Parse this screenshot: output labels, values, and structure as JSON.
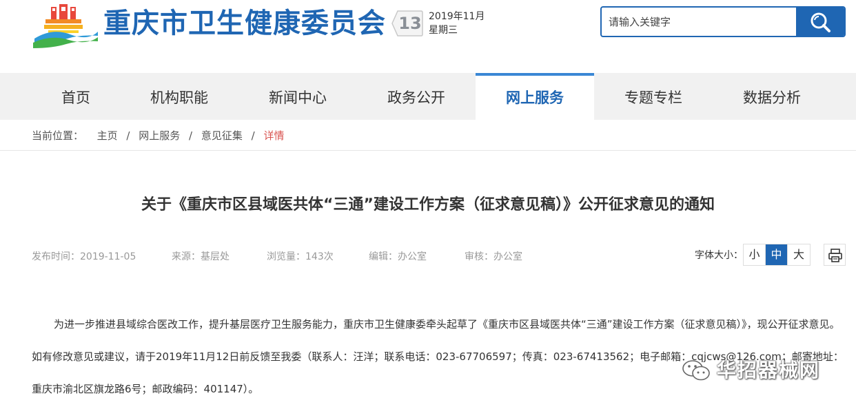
{
  "header": {
    "site_title": "重庆市卫生健康委员会",
    "date_day": "13",
    "date_month": "2019年11月",
    "date_weekday": "星期三"
  },
  "search": {
    "placeholder": "请输入关键字",
    "button_icon": "search-icon"
  },
  "nav": {
    "items": [
      {
        "label": "首页"
      },
      {
        "label": "机构职能"
      },
      {
        "label": "新闻中心"
      },
      {
        "label": "政务公开"
      },
      {
        "label": "网上服务"
      },
      {
        "label": "专题专栏"
      },
      {
        "label": "数据分析"
      }
    ],
    "active_index": 4
  },
  "breadcrumb": {
    "label": "当前位置：",
    "items": [
      "主页",
      "网上服务",
      "意见征集"
    ],
    "current": "详情",
    "separator": "/"
  },
  "article": {
    "title": "关于《重庆市区县域医共体“三通”建设工作方案（征求意见稿）》公开征求意见的通知",
    "meta": {
      "publish": "发布时间：2019-11-05",
      "source": "来源：基层处",
      "views": "浏览量：143次",
      "editor": "编辑：办公室",
      "reviewer": "审核：办公室"
    },
    "font_size_label": "字体大小：",
    "font_sizes": [
      "小",
      "中",
      "大"
    ],
    "font_size_active": "中",
    "body": "为进一步推进县域综合医改工作，提升基层医疗卫生服务能力，重庆市卫生健康委牵头起草了《重庆市区县域医共体“三通”建设工作方案（征求意见稿）》，现公开征求意见。如有修改意见或建议，请于2019年11月12日前反馈至我委（联系人：汪洋；联系电话：023-67706597；传真：023-67413562；电子邮箱：cqjcws@126.com；邮寄地址：重庆市渝北区旗龙路6号；邮政编码：401147）。"
  },
  "watermark": {
    "text": "华招器械网",
    "icon": "wechat-icon"
  },
  "colors": {
    "brand_blue": "#1f66b3",
    "active_red": "#d9534f"
  }
}
